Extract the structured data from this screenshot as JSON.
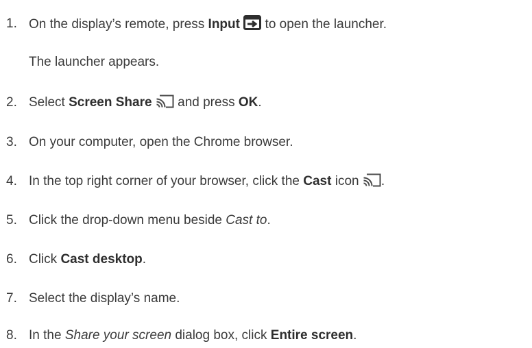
{
  "steps": [
    {
      "number": "1.",
      "pre": "On the display’s remote, press ",
      "bold1": "Input",
      "icon": "input-icon",
      "post": " to open the launcher.",
      "result": "The launcher appears."
    },
    {
      "number": "2.",
      "pre": "Select ",
      "bold1": "Screen Share",
      "icon": "cast-icon",
      "mid": " and press ",
      "bold2": "OK",
      "post": "."
    },
    {
      "number": "3.",
      "text": "On your computer, open the Chrome browser."
    },
    {
      "number": "4.",
      "pre": "In the top right corner of your browser, click the ",
      "bold1": "Cast",
      "mid": " icon ",
      "icon": "cast-icon",
      "post": "."
    },
    {
      "number": "5.",
      "pre": "Click the drop-down menu beside ",
      "italic1": "Cast to",
      "post": "."
    },
    {
      "number": "6.",
      "pre": "Click ",
      "bold1": "Cast desktop",
      "post": "."
    },
    {
      "number": "7.",
      "text": "Select the display’s name."
    },
    {
      "number": "8.",
      "pre": "In the ",
      "italic1": "Share your screen",
      "mid": " dialog box, click ",
      "bold1": "Entire screen",
      "post": "."
    }
  ]
}
